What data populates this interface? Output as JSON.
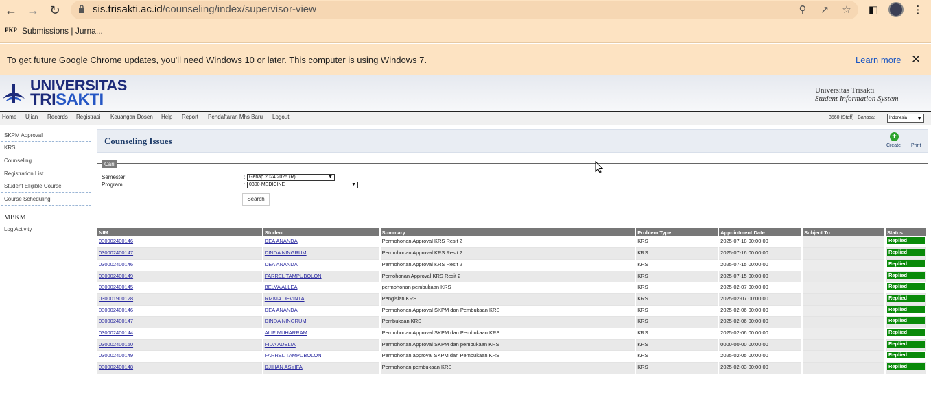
{
  "browser": {
    "url_host": "sis.trisakti.ac.id",
    "url_path": "/counseling/index/supervisor-view",
    "bookmark_icon": "PKP",
    "bookmark": "Submissions | Jurna...",
    "infobar_text": "To get future Google Chrome updates, you'll need Windows 10 or later. This computer is using Windows 7.",
    "learn_more": "Learn more"
  },
  "header": {
    "logo_line1": "UNIVERSITAS",
    "logo_line2a": "TRI",
    "logo_line2b": "SAKTI",
    "system_line1": "Universitas Trisakti",
    "system_line2": "Student Information System"
  },
  "menu": [
    "Home",
    "Ujian",
    "Records",
    "Registrasi",
    "Keuangan Dosen",
    "Help",
    "Report",
    "Pendaftaran Mhs Baru",
    "Logout"
  ],
  "user": {
    "staff_label": "3560 (Staff) |  Bahasa:",
    "language": "Indonesia"
  },
  "sidebar": {
    "items": [
      "SKPM Approval",
      "KRS",
      "Counseling",
      "Registration List",
      "Student Eligible Course",
      "Course Scheduling"
    ],
    "section": "MBKM",
    "section_items": [
      "Log Activity"
    ]
  },
  "page": {
    "title": "Counseling Issues",
    "create": "Create",
    "print": "Print"
  },
  "search": {
    "legend": "Cari",
    "semester_label": "Semester",
    "semester_value": "Genap 2024/2025 (R)",
    "program_label": "Program",
    "program_value": "0300-MEDICINE",
    "button": "Search"
  },
  "table": {
    "headers": [
      "NIM",
      "Student",
      "Summary",
      "Problem Type",
      "Appointment Date",
      "Subject To",
      "Status"
    ],
    "rows": [
      [
        "030002400146",
        "DEA ANANDA",
        "Permohonan Approval KRS Resit 2",
        "KRS",
        "2025-07-18 00:00:00",
        "",
        "Replied"
      ],
      [
        "030002400147",
        "DINDA NINGRUM",
        "Permohonan Approval KRS Resit 2",
        "KRS",
        "2025-07-16 00:00:00",
        "",
        "Replied"
      ],
      [
        "030002400146",
        "DEA ANANDA",
        "Permohonan Approval KRS Resit 2",
        "KRS",
        "2025-07-15 00:00:00",
        "",
        "Replied"
      ],
      [
        "030002400149",
        "FARREL TAMPUBOLON",
        "Pemohonan Approval KRS Resit 2",
        "KRS",
        "2025-07-15 00:00:00",
        "",
        "Replied"
      ],
      [
        "030002400145",
        "BELVA ALLEA",
        "permohonan pembukaan KRS",
        "KRS",
        "2025-02-07 00:00:00",
        "",
        "Replied"
      ],
      [
        "030001900128",
        "RIZKIA DEVINTA",
        "Pengisian KRS",
        "KRS",
        "2025-02-07 00:00:00",
        "",
        "Replied"
      ],
      [
        "030002400146",
        "DEA ANANDA",
        "Permohonan Approval SKPM dan Pembukaan KRS",
        "KRS",
        "2025-02-06 00:00:00",
        "",
        "Replied"
      ],
      [
        "030002400147",
        "DINDA NINGRUM",
        "Pembukaan KRS",
        "KRS",
        "2025-02-06 00:00:00",
        "",
        "Replied"
      ],
      [
        "030002400144",
        "ALIF MUHARRAM",
        "Permohonan Approval SKPM dan Pembukaan KRS",
        "KRS",
        "2025-02-06 00:00:00",
        "",
        "Replied"
      ],
      [
        "030002400150",
        "FIDA ADELIA",
        "Permohonan Approval SKPM dan pembukaan KRS",
        "KRS",
        "0000-00-00 00:00:00",
        "",
        "Replied"
      ],
      [
        "030002400149",
        "FARREL TAMPUBOLON",
        "Permohonan approval SKPM dan Pembukaan KRS",
        "KRS",
        "2025-02-05 00:00:00",
        "",
        "Replied"
      ],
      [
        "030002400148",
        "DJIHAN ASYIFA",
        "Permohonan pembukaan KRS",
        "KRS",
        "2025-02-03 00:00:00",
        "",
        "Replied"
      ]
    ]
  }
}
